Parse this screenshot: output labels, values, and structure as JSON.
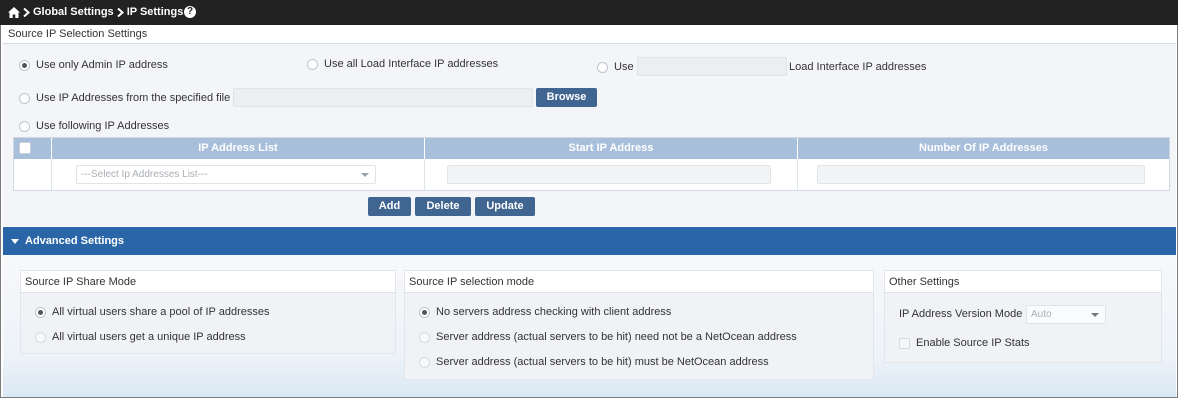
{
  "breadcrumb": {
    "icon": "home-icon",
    "items": [
      "Global Settings",
      "IP Settings"
    ],
    "help_icon": "help-icon",
    "help_glyph": "?"
  },
  "section": {
    "title": "Source IP Selection Settings"
  },
  "source_ip": {
    "options": {
      "admin_only": "Use only Admin IP address",
      "all_load": "Use all Load Interface IP addresses",
      "use_prefix": "Use",
      "use_suffix": "Load Interface IP addresses",
      "from_file": "Use IP Addresses from the specified file",
      "following": "Use following IP Addresses"
    },
    "selected": "admin_only",
    "use_count_value": "",
    "file_path_value": "",
    "browse_label": "Browse"
  },
  "ip_grid": {
    "columns": [
      "IP Address List",
      "Start IP Address",
      "Number Of IP Addresses"
    ],
    "row": {
      "list_placeholder": "---Select Ip Addresses List---",
      "start_ip": "",
      "count": ""
    }
  },
  "grid_buttons": {
    "add": "Add",
    "delete": "Delete",
    "update": "Update"
  },
  "advanced": {
    "title": "Advanced Settings",
    "share_mode": {
      "title": "Source IP Share Mode",
      "options": [
        "All virtual users share a pool of IP addresses",
        "All virtual users get a unique IP address"
      ],
      "selected_index": 0
    },
    "selection_mode": {
      "title": "Source IP selection mode",
      "options": [
        "No servers address checking with client address",
        "Server address (actual servers to be hit) need not be a NetOcean address",
        "Server address (actual servers to be hit) must be NetOcean address"
      ],
      "selected_index": 0
    },
    "other": {
      "title": "Other Settings",
      "version_label": "IP Address Version Mode",
      "version_value": "Auto",
      "stats_label": "Enable Source IP Stats",
      "stats_checked": false
    }
  },
  "colors": {
    "topbar": "#222222",
    "accent": "#2a66a7",
    "button": "#3f6590",
    "grid_header": "#a8bfdc"
  }
}
